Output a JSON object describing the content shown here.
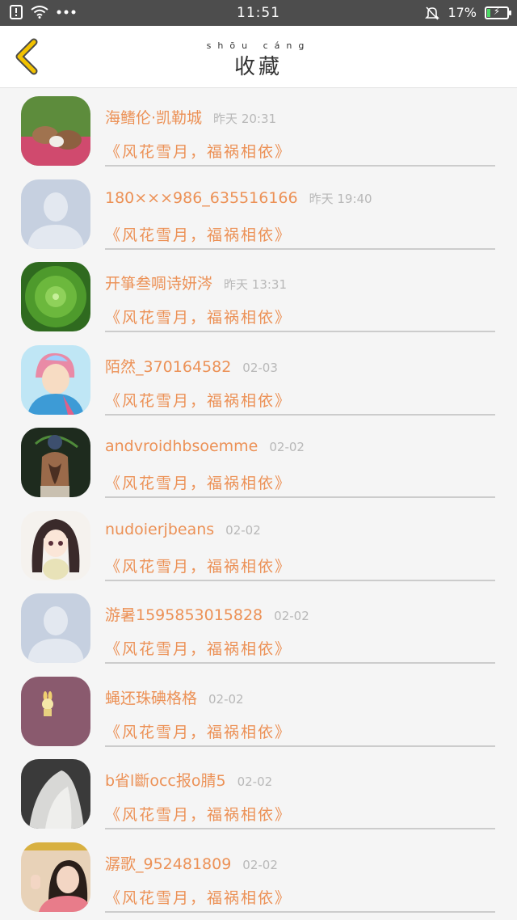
{
  "status_bar": {
    "time": "11:51",
    "battery_percent": "17%",
    "battery_level": 0.17
  },
  "header": {
    "title": "收藏",
    "title_ruby": "shōu cáng"
  },
  "colors": {
    "accent": "#ec9156",
    "back_arrow": "#f2c200",
    "status_bar": "#4d4d4d"
  },
  "favorites": [
    {
      "name": "海鳍伦·凯勒城",
      "time": "昨天 20:31",
      "message": "《风花雪月，福祸相依》",
      "avatar": "rabbits-photo"
    },
    {
      "name": "180×××986_635516166",
      "time": "昨天 19:40",
      "message": "《风花雪月，福祸相依》",
      "avatar": "default-user"
    },
    {
      "name": "开箏叁啁诗妍涔",
      "time": "昨天 13:31",
      "message": "《风花雪月，福祸相依》",
      "avatar": "cactus-photo"
    },
    {
      "name": "陌然_370164582",
      "time": "02-03",
      "message": "《风花雪月，福祸相依》",
      "avatar": "anime-boy"
    },
    {
      "name": "andvroidhbsoemme",
      "time": "02-02",
      "message": "《风花雪月，福祸相依》",
      "avatar": "tattooed-back"
    },
    {
      "name": "nudoierjbeans",
      "time": "02-02",
      "message": "《风花雪月，福祸相依》",
      "avatar": "anime-girl"
    },
    {
      "name": "游暑1595853015828",
      "time": "02-02",
      "message": "《风花雪月，福祸相依》",
      "avatar": "default-user"
    },
    {
      "name": "蝇还珠碘格格",
      "time": "02-02",
      "message": "《风花雪月，福祸相依》",
      "avatar": "small-figure"
    },
    {
      "name": "b省l斷occ报o腈5",
      "time": "02-02",
      "message": "《风花雪月，福祸相依》",
      "avatar": "white-sculpture"
    },
    {
      "name": "潺歌_952481809",
      "time": "02-02",
      "message": "《风花雪月，福祸相依》",
      "avatar": "girl-photo"
    }
  ]
}
